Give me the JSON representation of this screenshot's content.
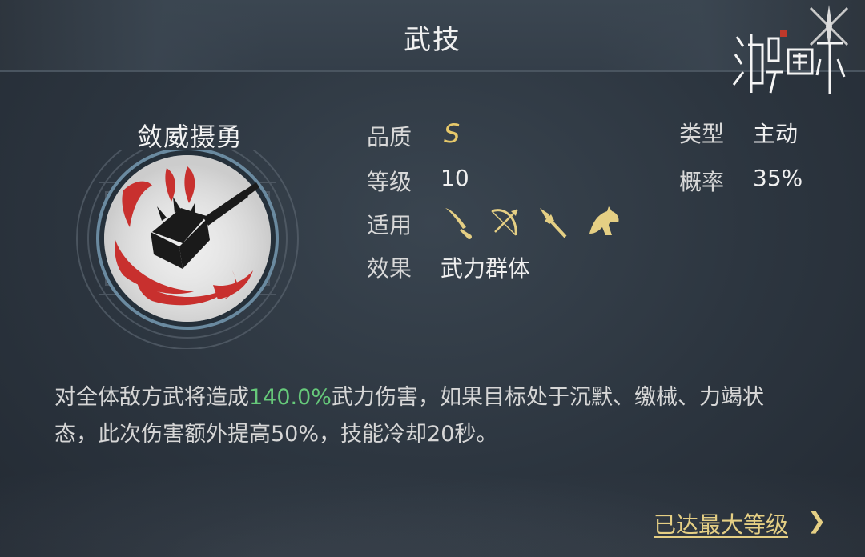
{
  "header": {
    "title": "武技",
    "logo_text": "鸿图之下"
  },
  "skill": {
    "name": "敛威摄勇",
    "icon": "spiked-mace-icon",
    "quality_label": "品质",
    "quality_value": "S",
    "level_label": "等级",
    "level_value": "10",
    "applies_label": "适用",
    "applies_icons": [
      "sword-icon",
      "bow-icon",
      "spear-icon",
      "horse-icon"
    ],
    "effect_label": "效果",
    "effect_value": "武力群体",
    "type_label": "类型",
    "type_value": "主动",
    "chance_label": "概率",
    "chance_value": "35%"
  },
  "description": {
    "before": "对全体敌方武将造成",
    "highlight": "140.0%",
    "after": "武力伤害，如果目标处于沉默、缴械、力竭状态，此次伤害额外提高50%，技能冷却20秒。"
  },
  "footer": {
    "max_level_label": "已达最大等级",
    "chevron": "❯"
  },
  "colors": {
    "gold": "#e5cf84",
    "highlight_green": "#66c97a",
    "background": "#2c353f"
  }
}
